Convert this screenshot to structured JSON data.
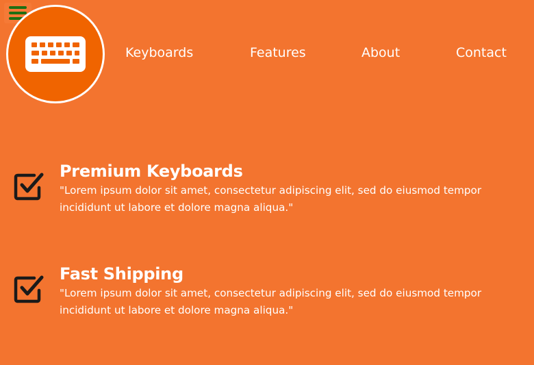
{
  "header": {
    "menu_icon": "hamburger-icon",
    "menu_icon_color": "#1f6f13",
    "logo_icon": "keyboard-icon",
    "logo_background": "#f06400"
  },
  "nav": {
    "items": [
      {
        "label": "Keyboards"
      },
      {
        "label": "Features"
      },
      {
        "label": "About"
      },
      {
        "label": "Contact"
      }
    ]
  },
  "features": [
    {
      "icon": "checkbox-checked-icon",
      "title": "Premium Keyboards",
      "text": "\"Lorem ipsum dolor sit amet, consectetur adipiscing elit, sed do eiusmod tempor incididunt ut labore et dolore magna aliqua.\""
    },
    {
      "icon": "checkbox-checked-icon",
      "title": "Fast Shipping",
      "text": "\"Lorem ipsum dolor sit amet, consectetur adipiscing elit, sed do eiusmod tempor incididunt ut labore et dolore magna aliqua.\""
    }
  ],
  "colors": {
    "page_background": "#f3742f",
    "text": "#ffffff",
    "icon_dark": "#1a1a1a"
  }
}
